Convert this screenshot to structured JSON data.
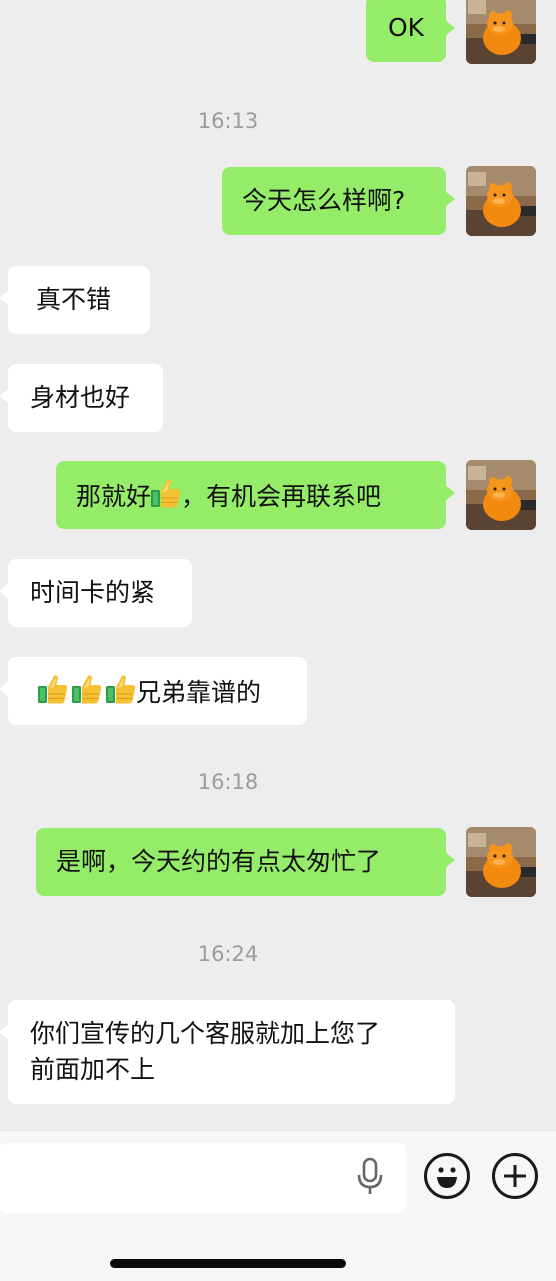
{
  "colors": {
    "outgoing_bubble": "#95ec69",
    "incoming_bubble": "#ffffff",
    "background": "#ededed",
    "timestamp": "#9b9b9b"
  },
  "messages": [
    {
      "side": "out",
      "text": "OK"
    },
    {
      "type": "time",
      "text": "16:13"
    },
    {
      "side": "out",
      "text": "今天怎么样啊?"
    },
    {
      "side": "in",
      "text": "真不错"
    },
    {
      "side": "in",
      "text": "身材也好"
    },
    {
      "side": "out",
      "prefix": "那就好",
      "emoji": "thumbs-up-icon",
      "suffix": "，有机会再联系吧"
    },
    {
      "side": "in",
      "text": "时间卡的紧"
    },
    {
      "side": "in",
      "emojis": [
        "thumbs-up-icon",
        "thumbs-up-icon",
        "thumbs-up-icon"
      ],
      "suffix": "兄弟靠谱的"
    },
    {
      "type": "time",
      "text": "16:18"
    },
    {
      "side": "out",
      "text": "是啊，今天约的有点太匆忙了"
    },
    {
      "type": "time",
      "text": "16:24"
    },
    {
      "side": "in",
      "lines": [
        "你们宣传的几个客服就加上您了",
        "前面加不上"
      ]
    }
  ],
  "input_bar": {
    "input_value": "",
    "icons": [
      "voice-icon",
      "emoji-icon",
      "plus-icon"
    ]
  }
}
